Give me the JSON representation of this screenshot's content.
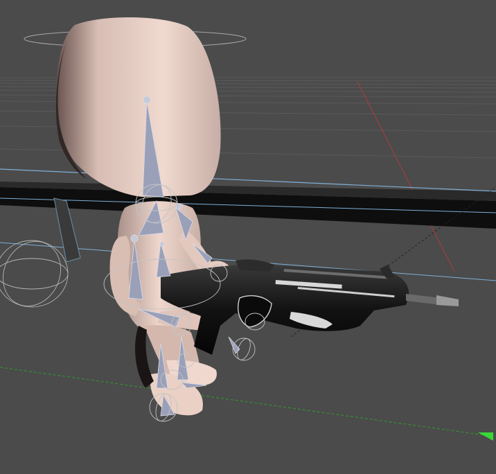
{
  "viewport": {
    "background_color": "#4b4b4b",
    "grid_color": "#5d5d5d",
    "selection_outline_color": "#7fb0d8",
    "axis_x_color": "#b23a3a",
    "axis_z_color": "#2f9e2f",
    "bone_color": "#9aa0b8",
    "character_skin_color": "#e8cfc4",
    "weapon_color": "#161616",
    "icons": [
      "move-gizmo-arrow-icon",
      "root-control-circle-icon",
      "joint-control-circle-icon"
    ]
  }
}
